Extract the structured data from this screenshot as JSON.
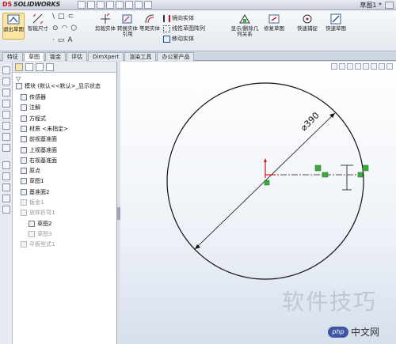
{
  "app": {
    "brand_ds": "DS",
    "brand_name": "SOLIDWORKS",
    "window_title": "草图1 *"
  },
  "ribbon": {
    "exit_sketch": "退出草图",
    "smart_dimension": "智能尺寸",
    "trim": "剪裁实体",
    "convert": "转换实体引用",
    "offset": "等距实体",
    "mirror": "镜向实体",
    "linear_pattern": "线性草图阵列",
    "move": "移动实体",
    "display_relations": "显示/删除几何关系",
    "repair": "修复草图",
    "quick_snaps": "快速捕捉",
    "rapid_sketch": "快速草图"
  },
  "tabs": [
    {
      "label": "特征",
      "active": false
    },
    {
      "label": "草图",
      "active": true
    },
    {
      "label": "钣金",
      "active": false
    },
    {
      "label": "评估",
      "active": false
    },
    {
      "label": "DimXpert",
      "active": false
    },
    {
      "label": "渲染工具",
      "active": false
    },
    {
      "label": "办公室产品",
      "active": false
    }
  ],
  "tree": {
    "root": "模块 (默认<<默认>_显示状态",
    "items": [
      {
        "label": "传感器",
        "gray": false
      },
      {
        "label": "注解",
        "gray": false
      },
      {
        "label": "方程式",
        "gray": false
      },
      {
        "label": "材质 <未指定>",
        "gray": false
      },
      {
        "label": "前视基准面",
        "gray": false
      },
      {
        "label": "上视基准面",
        "gray": false
      },
      {
        "label": "右视基准面",
        "gray": false
      },
      {
        "label": "原点",
        "gray": false
      },
      {
        "label": "草图1",
        "gray": false
      },
      {
        "label": "基准面2",
        "gray": false
      },
      {
        "label": "钣金1",
        "gray": true
      },
      {
        "label": "放样折弯1",
        "gray": true
      },
      {
        "label": "草图2",
        "gray": false
      },
      {
        "label": "草图3",
        "gray": true
      },
      {
        "label": "平板型式1",
        "gray": true
      }
    ]
  },
  "sketch": {
    "dimension": "⌀390"
  },
  "watermark": {
    "text": "软件技巧",
    "site": "中文网",
    "site_badge": "php"
  }
}
